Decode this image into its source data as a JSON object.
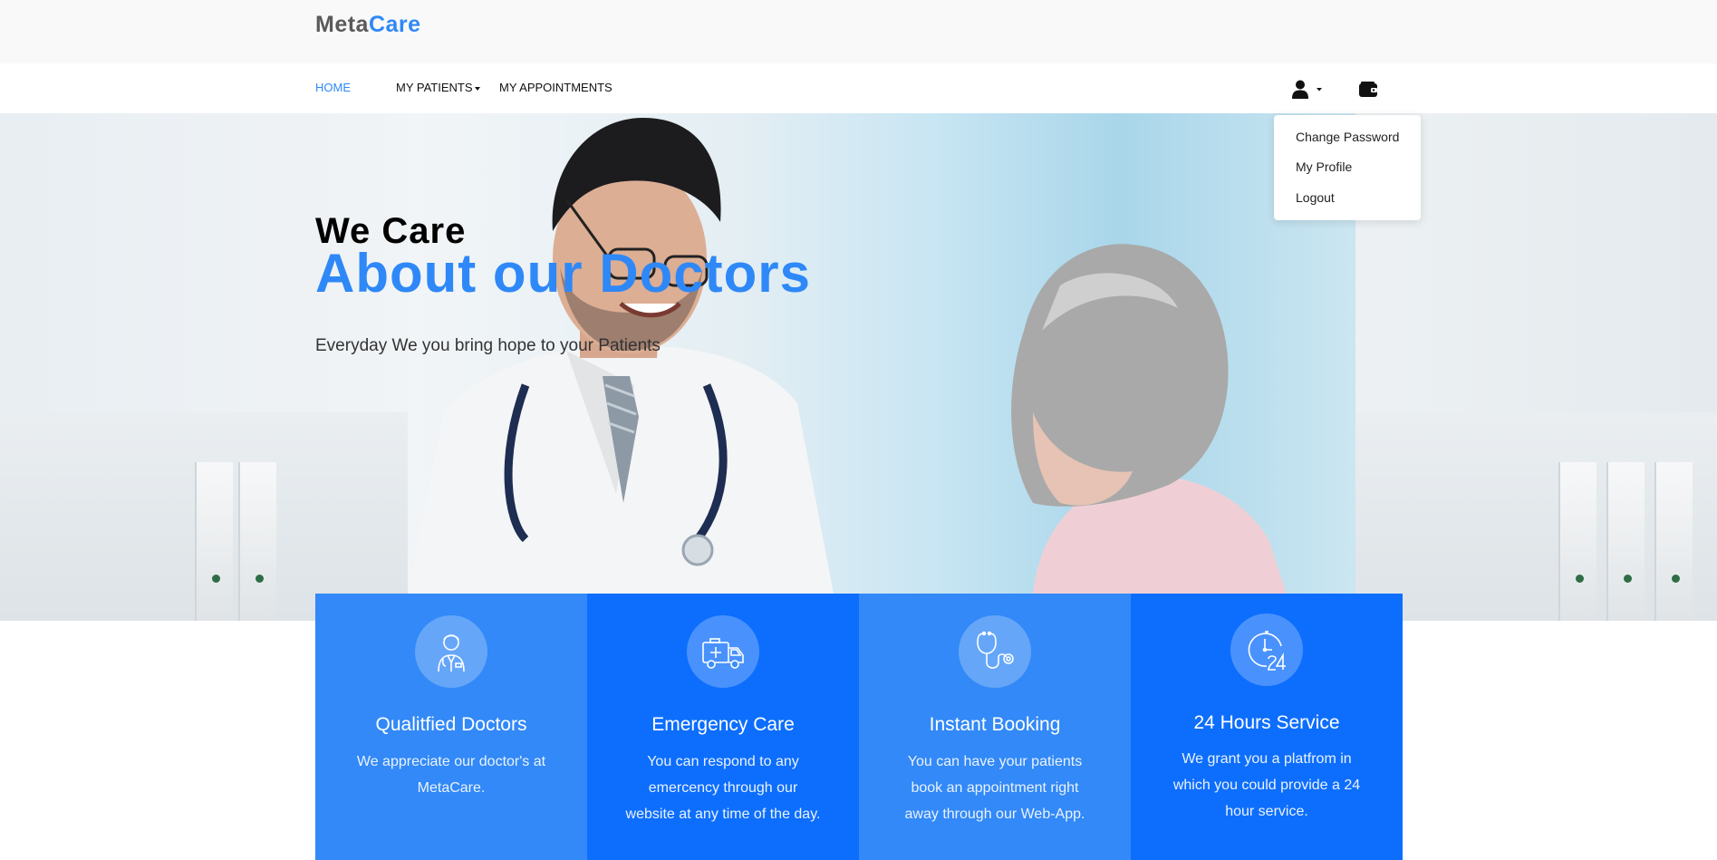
{
  "brand": {
    "part1": "Meta",
    "part2": "Care"
  },
  "nav": {
    "home": "HOME",
    "patients": "MY PATIENTS",
    "appointments": "MY APPOINTMENTS"
  },
  "user_menu": {
    "items": [
      "Change Password",
      "My Profile",
      "Logout"
    ]
  },
  "icons": {
    "user": "user-icon",
    "wallet": "wallet-icon"
  },
  "hero": {
    "line1": "We Care",
    "line2": "About our Doctors",
    "subtitle": "Everyday We you bring hope to your Patients"
  },
  "features": [
    {
      "icon": "doctor-icon",
      "title": "Qualitfied Doctors",
      "description": "We appreciate our doctor's at MetaCare."
    },
    {
      "icon": "ambulance-icon",
      "title": "Emergency Care",
      "description": "You can respond to any emercency through our website at any time of the day."
    },
    {
      "icon": "stethoscope-icon",
      "title": "Instant Booking",
      "description": "You can have your patients book an appointment right away through our Web-App."
    },
    {
      "icon": "clock-24-icon",
      "title": "24 Hours Service",
      "description": "We grant you a platfrom in which you could provide a 24 hour service."
    }
  ],
  "colors": {
    "accent": "#2f88f7",
    "feature_light": "#3289f7",
    "feature_dark": "#0d6efd"
  }
}
